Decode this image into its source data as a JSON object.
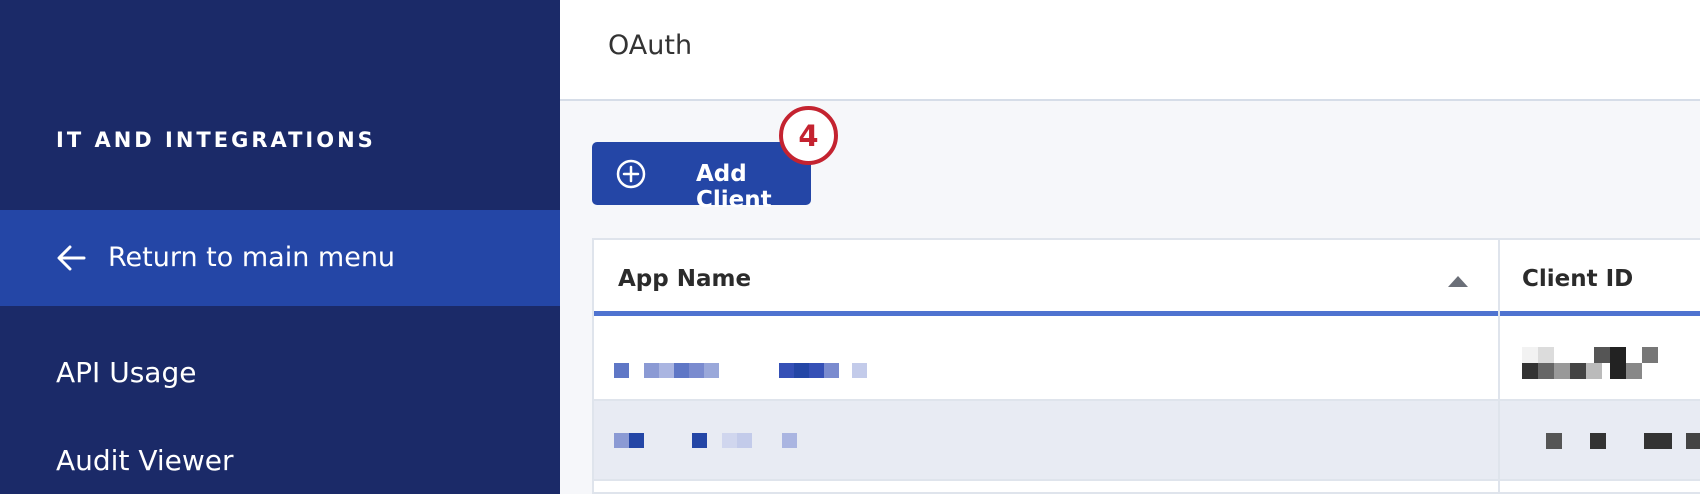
{
  "sidebar": {
    "section_heading": "IT AND INTEGRATIONS",
    "return_label": "Return to main menu",
    "items": [
      {
        "label": "API Usage"
      },
      {
        "label": "Audit Viewer"
      }
    ]
  },
  "header": {
    "title": "OAuth"
  },
  "toolbar": {
    "add_client_label": "Add Client",
    "step_badge": "4"
  },
  "table": {
    "columns": [
      {
        "label": "App Name",
        "sorted": "ascending"
      },
      {
        "label": "Client ID"
      }
    ],
    "rows_redacted": 2
  },
  "colors": {
    "sidebar_bg": "#1b2a68",
    "sidebar_active_bg": "#2446a6",
    "button_bg": "#2446a6",
    "badge_red": "#c42330",
    "header_underline": "#4f73d0",
    "alt_row_bg": "#e8ebf3"
  },
  "icons": {
    "return": "arrow-left-icon",
    "add": "plus-circle-icon",
    "sort": "sort-ascending-icon"
  }
}
